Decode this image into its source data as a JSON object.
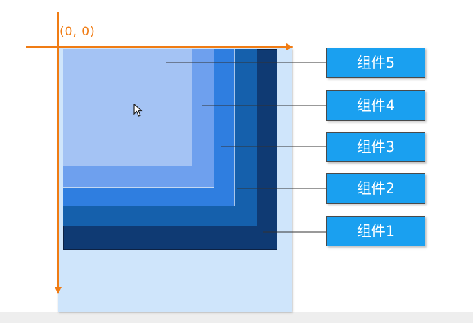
{
  "origin_label": "(0, 0)",
  "colors": {
    "axis": "#f07c14",
    "button": "#1aa0f0",
    "leader_line": "#333333",
    "layer_1": "#0f3a73",
    "layer_2": "#1560ac",
    "layer_3": "#2f7ee0",
    "layer_4": "#6ea0ee",
    "layer_5": "#a4c3f4",
    "canvas": "#cfe5fb"
  },
  "components": [
    {
      "id": "5",
      "label": "组件5"
    },
    {
      "id": "4",
      "label": "组件4"
    },
    {
      "id": "3",
      "label": "组件3"
    },
    {
      "id": "2",
      "label": "组件2"
    },
    {
      "id": "1",
      "label": "组件1"
    }
  ],
  "cursor_icon": "arrow-pointer-icon"
}
